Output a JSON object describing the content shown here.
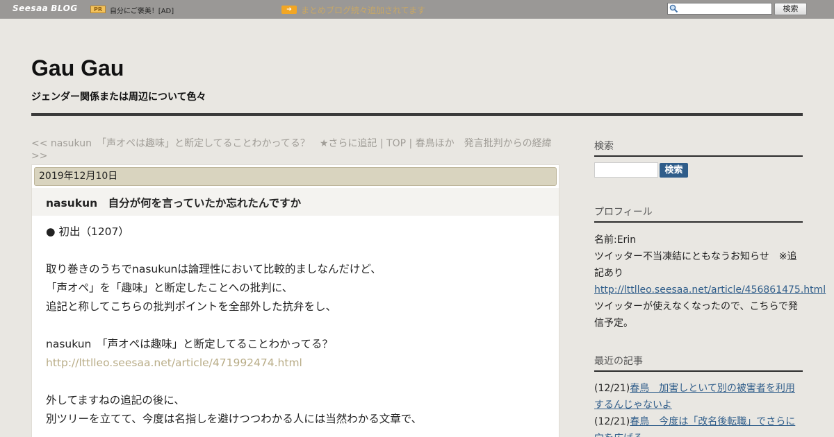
{
  "topbar": {
    "logo_brand": "Seesaa",
    "logo_blog": "BLOG",
    "pr_badge": "PR",
    "pr_text": "自分にご褒美！[AD]",
    "promo_icon": "➔",
    "promo_text": "まとめブログ続々追加されてます",
    "search_placeholder": "",
    "search_button": "検索"
  },
  "header": {
    "title": "Gau Gau",
    "description": "ジェンダー関係または周辺について色々"
  },
  "nav": {
    "prev": "<< nasukun　「声オペは趣味」と断定してることわかってる？　★さらに追記",
    "sep1": " | ",
    "top": "TOP",
    "sep2": " | ",
    "next": "春鳥ほか　発言批判からの経緯 >>"
  },
  "article": {
    "date": "2019年12月10日",
    "title": "nasukun　自分が何を言っていたか忘れたんですか",
    "lines": [
      "● 初出（1207）",
      "",
      "取り巻きのうちでnasukunは論理性において比較的ましなんだけど、",
      "「声オペ」を「趣味」と断定したことへの批判に、",
      "追記と称してこちらの批判ポイントを全部外した抗弁をし、",
      "",
      "nasukun　「声オペは趣味」と断定してることわかってる？",
      "",
      "",
      "外してますねの追記の後に、",
      "別ツリーを立てて、今度は名指しを避けつつわかる人には当然わかる文章で、"
    ],
    "link": "http://lttlleo.seesaa.net/article/471992474.html"
  },
  "sidebar": {
    "search_heading": "検索",
    "search_button": "検索",
    "profile_heading": "プロフィール",
    "profile_name": "名前:Erin",
    "profile_note": "ツイッター不当凍結にともなうお知らせ　※追記あり",
    "profile_link": "http://lttlleo.seesaa.net/article/456861475.html",
    "profile_after": "ツイッターが使えなくなったので、こちらで発信予定。",
    "recent_heading": "最近の記事",
    "recent": [
      {
        "date": "(12/21)",
        "title": "春鳥　加害しといて別の被害者を利用するんじゃないよ"
      },
      {
        "date": "(12/21)",
        "title": "春鳥　今度は「改名後転職」でさらに穴を広げる"
      }
    ]
  },
  "colors": {
    "topbar_bg": "#9a9896",
    "page_bg": "#e9e7e2",
    "date_bar": "#d9d4bf",
    "link_blue": "#2f5d8a",
    "article_link": "#b9ad88",
    "promo_orange": "#f2a623"
  },
  "icons": {
    "search": "magnifier-icon",
    "promo": "arrow-right-icon"
  }
}
